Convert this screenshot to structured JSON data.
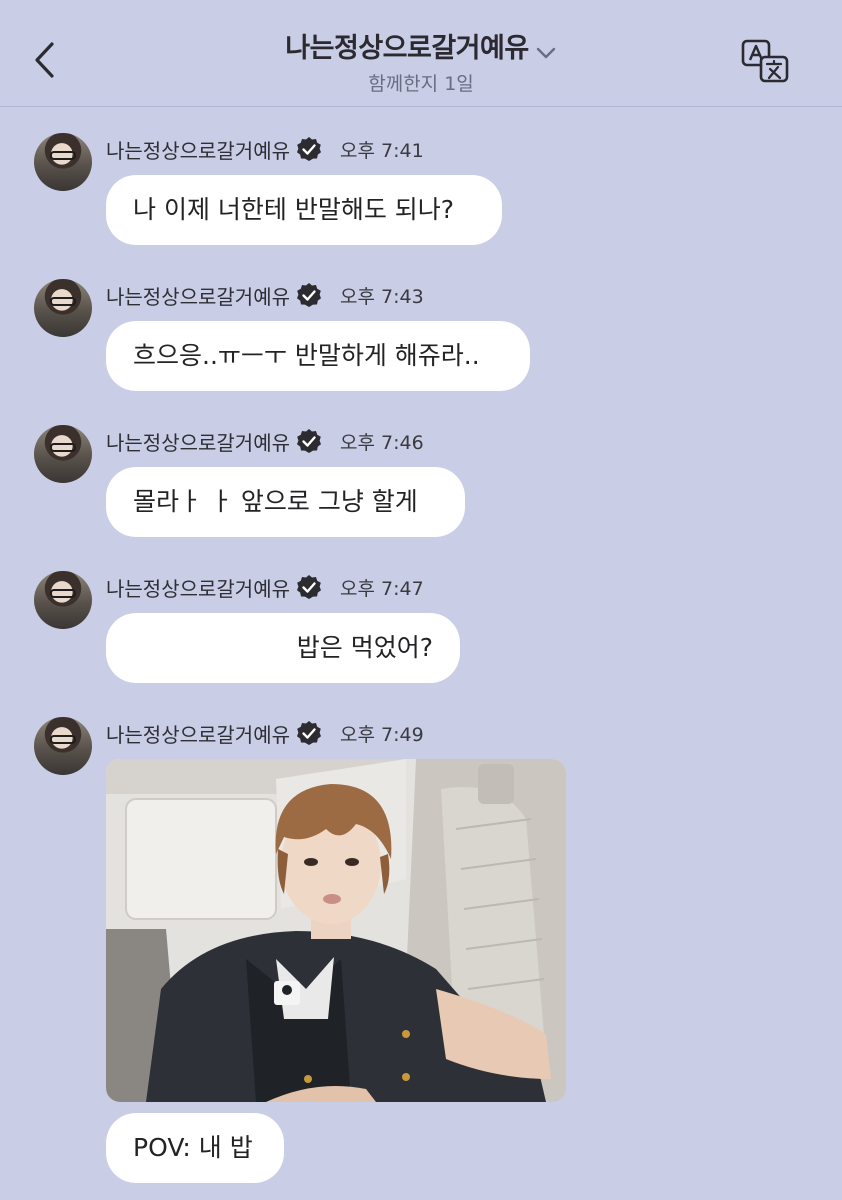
{
  "header": {
    "title": "나는정상으로갈거예유",
    "subtitle": "함께한지 1일"
  },
  "messages": [
    {
      "sender": "나는정상으로갈거예유",
      "time": "오후 7:41",
      "text": "나 이제 너한테 반말해도 되나?"
    },
    {
      "sender": "나는정상으로갈거예유",
      "time": "오후 7:43",
      "text": "흐으응..ㅠㅡㅜ 반말하게 해쥬라.."
    },
    {
      "sender": "나는정상으로갈거예유",
      "time": "오후 7:46",
      "text": "몰라ㅏ ㅏ 앞으로 그냥 할게"
    },
    {
      "sender": "나는정상으로갈거예유",
      "time": "오후 7:47",
      "text": "밥은 먹었어?"
    },
    {
      "sender": "나는정상으로갈거예유",
      "time": "오후 7:49",
      "text": "POV: 내 밥"
    }
  ],
  "colors": {
    "background": "#c9cde6",
    "bubble": "#ffffff",
    "verified_badge": "#2b2b30"
  },
  "icons": {
    "back": "chevron-left-icon",
    "title_dropdown": "chevron-down-icon",
    "translate": "translate-icon",
    "verified": "verified-badge-icon"
  }
}
